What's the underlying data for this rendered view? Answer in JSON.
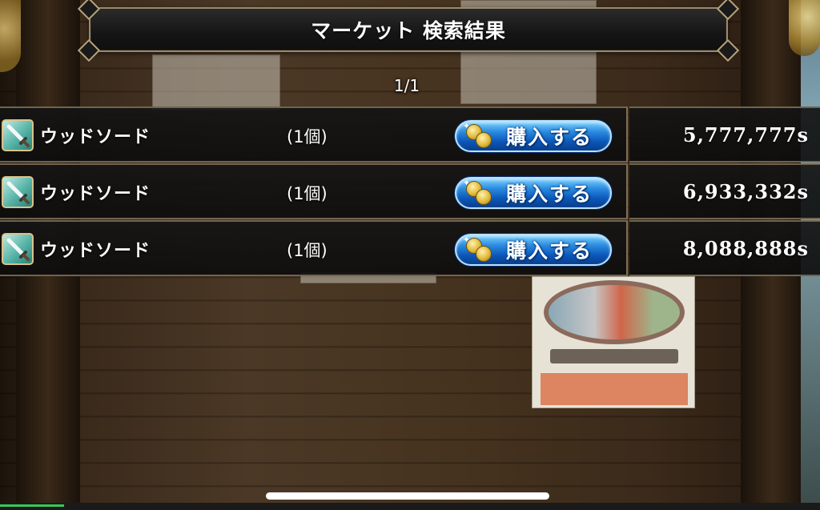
{
  "header": {
    "title": "マーケット 検索結果"
  },
  "pagination": {
    "text": "1/1"
  },
  "results": [
    {
      "name": "ウッドソード",
      "quantity": "(1個)",
      "buy_label": "購入する",
      "price": "5,777,777s",
      "icon": "wood-sword-icon"
    },
    {
      "name": "ウッドソード",
      "quantity": "(1個)",
      "buy_label": "購入する",
      "price": "6,933,332s",
      "icon": "wood-sword-icon"
    },
    {
      "name": "ウッドソード",
      "quantity": "(1個)",
      "buy_label": "購入する",
      "price": "8,088,888s",
      "icon": "wood-sword-icon"
    }
  ],
  "colors": {
    "buy_button": "#1a6fd0",
    "row_background": "#141414",
    "frame_gold": "#9a8a6e"
  }
}
